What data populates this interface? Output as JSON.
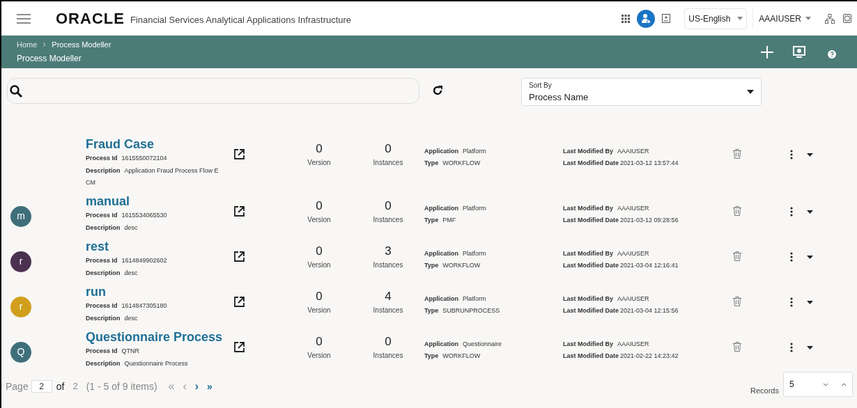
{
  "header": {
    "brand": "ORACLE",
    "product": "Financial Services Analytical Applications Infrastructure",
    "language": "US-English",
    "user": "AAAIUSER"
  },
  "banner": {
    "breadcrumbs": [
      "Home",
      "Process Modeller"
    ],
    "title": "Process Modeller"
  },
  "sort": {
    "label": "Sort By",
    "value": "Process Name"
  },
  "processes": [
    {
      "name": "Fraud Case",
      "process_id_label": "Process Id",
      "process_id": "1615550072104",
      "description_label": "Description",
      "description": "Application Fraud Process Flow ECM",
      "version": "0",
      "version_label": "Version",
      "instances": "0",
      "instances_label": "Instances",
      "application_label": "Application",
      "application": "Platform",
      "type_label": "Type",
      "type": "WORKFLOW",
      "modified_by_label": "Last Modified By",
      "modified_by": "AAAIUSER",
      "modified_date_label": "Last Modified Date",
      "modified_date": "2021-03-12 13:57:44"
    },
    {
      "avatar": {
        "letter": "m",
        "color": "#3f6f7b"
      },
      "name": "manual",
      "process_id_label": "Process Id",
      "process_id": "1615534065530",
      "description_label": "Description",
      "description": "desc",
      "version": "0",
      "version_label": "Version",
      "instances": "0",
      "instances_label": "Instances",
      "application_label": "Application",
      "application": "Platform",
      "type_label": "Type",
      "type": "PMF",
      "modified_by_label": "Last Modified By",
      "modified_by": "AAAIUSER",
      "modified_date_label": "Last Modified Date",
      "modified_date": "2021-03-12 09:28:56"
    },
    {
      "avatar": {
        "letter": "r",
        "color": "#4b3150"
      },
      "name": "rest",
      "process_id_label": "Process Id",
      "process_id": "1614849902602",
      "description_label": "Description",
      "description": "desc",
      "version": "0",
      "version_label": "Version",
      "instances": "3",
      "instances_label": "Instances",
      "application_label": "Application",
      "application": "Platform",
      "type_label": "Type",
      "type": "WORKFLOW",
      "modified_by_label": "Last Modified By",
      "modified_by": "AAAIUSER",
      "modified_date_label": "Last Modified Date",
      "modified_date": "2021-03-04 12:16:41"
    },
    {
      "avatar": {
        "letter": "r",
        "color": "#d19f1c"
      },
      "name": "run",
      "process_id_label": "Process Id",
      "process_id": "1614847305180",
      "description_label": "Description",
      "description": "desc",
      "version": "0",
      "version_label": "Version",
      "instances": "4",
      "instances_label": "Instances",
      "application_label": "Application",
      "application": "Platform",
      "type_label": "Type",
      "type": "SUBRUNPROCESS",
      "modified_by_label": "Last Modified By",
      "modified_by": "AAAIUSER",
      "modified_date_label": "Last Modified Date",
      "modified_date": "2021-03-04 12:15:56"
    },
    {
      "avatar": {
        "letter": "Q",
        "color": "#3f6f7b"
      },
      "name": "Questionnaire Process",
      "process_id_label": "Process Id",
      "process_id": "QTNR",
      "description_label": "Description",
      "description": "Questionnaire Process",
      "version": "0",
      "version_label": "Version",
      "instances": "0",
      "instances_label": "Instances",
      "application_label": "Application",
      "application": "Questionnaire",
      "type_label": "Type",
      "type": "WORKFLOW",
      "modified_by_label": "Last Modified By",
      "modified_by": "AAAIUSER",
      "modified_date_label": "Last Modified Date",
      "modified_date": "2021-02-22 14:23:42"
    }
  ],
  "pagination": {
    "page_label": "Page",
    "page": "2",
    "of": "of",
    "total_pages": "2",
    "summary": "(1 - 5 of 9 items)",
    "first": "«",
    "prev": "‹",
    "next": "›",
    "last": "»",
    "records_label": "Records",
    "records": "5"
  }
}
